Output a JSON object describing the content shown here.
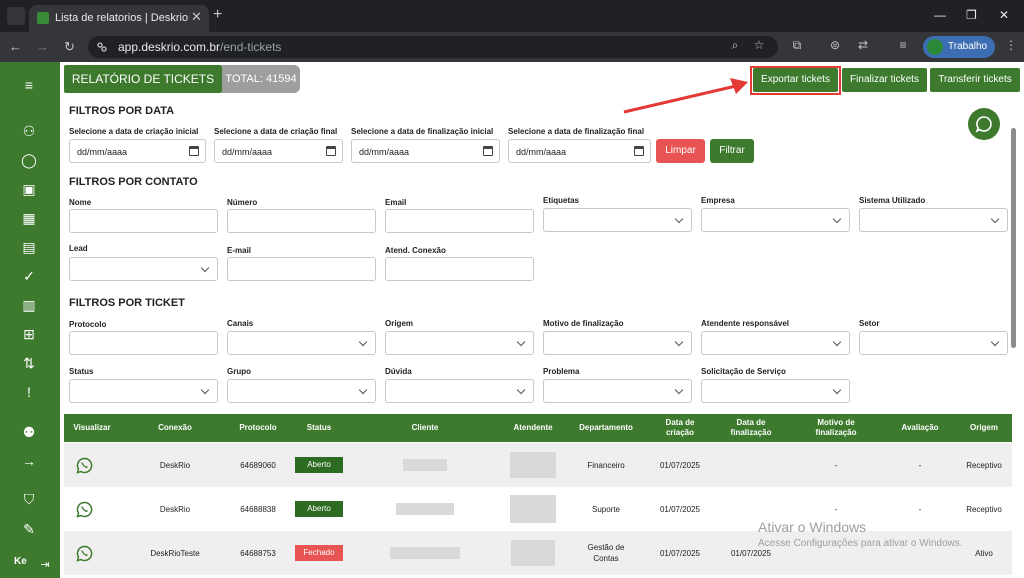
{
  "browser": {
    "tab_title": "Lista de relatorios | Deskrio",
    "url_domain": "app.deskrio.com.br",
    "url_path": "/end-tickets",
    "profile_label": "Trabalho"
  },
  "sidebar": {
    "bottom_label": "Ke"
  },
  "header": {
    "title": "RELATÓRIO DE TICKETS",
    "total": "TOTAL: 41594",
    "export_label": "Exportar tickets",
    "finalize_label": "Finalizar tickets",
    "transfer_label": "Transferir tickets"
  },
  "date_filters": {
    "title": "FILTROS POR DATA",
    "creation_start_label": "Selecione a data de criação inicial",
    "creation_end_label": "Selecione a data de criação final",
    "finalization_start_label": "Selecione a data de finalização inicial",
    "finalization_end_label": "Selecione a data de finalização final",
    "date_placeholder": "dd/mm/aaaa",
    "clear_label": "Limpar",
    "filter_label": "Filtrar"
  },
  "contact_filters": {
    "title": "FILTROS POR CONTATO",
    "name_label": "Nome",
    "number_label": "Número",
    "email_label": "Email",
    "tags_label": "Etiquetas",
    "company_label": "Empresa",
    "system_label": "Sistema Utilizado",
    "lead_label": "Lead",
    "email2_label": "E-mail",
    "connection_label": "Atend. Conexão"
  },
  "ticket_filters": {
    "title": "FILTROS POR TICKET",
    "protocol_label": "Protocolo",
    "channels_label": "Canais",
    "origin_label": "Origem",
    "reason_label": "Motivo de finalização",
    "agent_label": "Atendente responsável",
    "sector_label": "Setor",
    "status_label": "Status",
    "group_label": "Grupo",
    "question_label": "Dúvida",
    "problem_label": "Problema",
    "service_label": "Solicitação de Serviço"
  },
  "table": {
    "headers": [
      "Visualizar",
      "Conexão",
      "Protocolo",
      "Status",
      "Cliente",
      "Atendente",
      "Departamento",
      "Data de criação",
      "Data de finalização",
      "Motivo de finalização",
      "Avaliação",
      "Origem"
    ],
    "rows": [
      {
        "connection": "DeskRio",
        "protocol": "64689060",
        "status": "Aberto",
        "department": "Financeiro",
        "created": "01/07/2025",
        "finished": "",
        "reason": "-",
        "rating": "-",
        "origin": "Receptivo"
      },
      {
        "connection": "DeskRio",
        "protocol": "64688838",
        "status": "Aberto",
        "department": "Suporte",
        "created": "01/07/2025",
        "finished": "",
        "reason": "-",
        "rating": "-",
        "origin": "Receptivo"
      },
      {
        "connection": "DeskRioTeste",
        "protocol": "64688753",
        "status": "Fechado",
        "department": "Gestão de Contas",
        "created": "01/07/2025",
        "finished": "01/07/2025",
        "reason": "",
        "rating": "",
        "origin": "Ativo"
      }
    ]
  },
  "watermark": {
    "line1": "Ativar o Windows",
    "line2": "Acesse Configurações para ativar o Windows."
  },
  "colors": {
    "brand_green": "#3d7a2e",
    "status_open": "#2e6b22",
    "status_closed": "#e85454",
    "highlight_red": "#e53935"
  }
}
